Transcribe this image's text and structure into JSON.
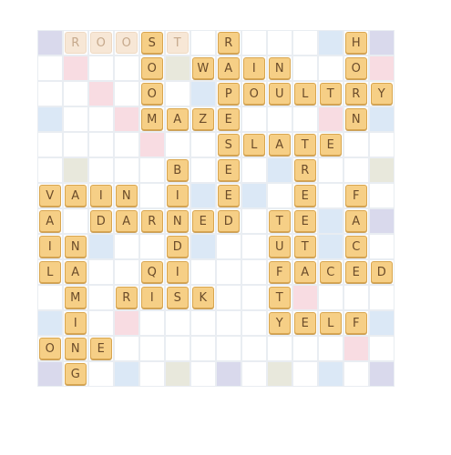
{
  "board": {
    "rows": 14,
    "cols": 14,
    "tiles": [
      {
        "r": 0,
        "c": 1,
        "l": "R",
        "ghost": true
      },
      {
        "r": 0,
        "c": 2,
        "l": "O",
        "ghost": true
      },
      {
        "r": 0,
        "c": 3,
        "l": "O",
        "ghost": true
      },
      {
        "r": 0,
        "c": 4,
        "l": "S"
      },
      {
        "r": 0,
        "c": 5,
        "l": "T",
        "ghost": true
      },
      {
        "r": 0,
        "c": 7,
        "l": "R"
      },
      {
        "r": 0,
        "c": 12,
        "l": "H"
      },
      {
        "r": 1,
        "c": 4,
        "l": "O"
      },
      {
        "r": 1,
        "c": 6,
        "l": "W"
      },
      {
        "r": 1,
        "c": 7,
        "l": "A"
      },
      {
        "r": 1,
        "c": 8,
        "l": "I"
      },
      {
        "r": 1,
        "c": 9,
        "l": "N"
      },
      {
        "r": 1,
        "c": 12,
        "l": "O"
      },
      {
        "r": 2,
        "c": 4,
        "l": "O"
      },
      {
        "r": 2,
        "c": 7,
        "l": "P"
      },
      {
        "r": 2,
        "c": 8,
        "l": "O"
      },
      {
        "r": 2,
        "c": 9,
        "l": "U"
      },
      {
        "r": 2,
        "c": 10,
        "l": "L"
      },
      {
        "r": 2,
        "c": 11,
        "l": "T"
      },
      {
        "r": 2,
        "c": 12,
        "l": "R"
      },
      {
        "r": 2,
        "c": 13,
        "l": "Y"
      },
      {
        "r": 3,
        "c": 4,
        "l": "M"
      },
      {
        "r": 3,
        "c": 5,
        "l": "A"
      },
      {
        "r": 3,
        "c": 6,
        "l": "Z"
      },
      {
        "r": 3,
        "c": 7,
        "l": "E"
      },
      {
        "r": 3,
        "c": 12,
        "l": "N"
      },
      {
        "r": 4,
        "c": 7,
        "l": "S"
      },
      {
        "r": 4,
        "c": 8,
        "l": "L"
      },
      {
        "r": 4,
        "c": 9,
        "l": "A"
      },
      {
        "r": 4,
        "c": 10,
        "l": "T"
      },
      {
        "r": 4,
        "c": 11,
        "l": "E"
      },
      {
        "r": 5,
        "c": 5,
        "l": "B"
      },
      {
        "r": 5,
        "c": 7,
        "l": "E"
      },
      {
        "r": 5,
        "c": 10,
        "l": "R"
      },
      {
        "r": 6,
        "c": 0,
        "l": "V"
      },
      {
        "r": 6,
        "c": 1,
        "l": "A"
      },
      {
        "r": 6,
        "c": 2,
        "l": "I"
      },
      {
        "r": 6,
        "c": 3,
        "l": "N"
      },
      {
        "r": 6,
        "c": 5,
        "l": "I"
      },
      {
        "r": 6,
        "c": 7,
        "l": "E"
      },
      {
        "r": 6,
        "c": 10,
        "l": "E"
      },
      {
        "r": 6,
        "c": 12,
        "l": "F"
      },
      {
        "r": 7,
        "c": 0,
        "l": "A"
      },
      {
        "r": 7,
        "c": 2,
        "l": "D"
      },
      {
        "r": 7,
        "c": 3,
        "l": "A"
      },
      {
        "r": 7,
        "c": 4,
        "l": "R"
      },
      {
        "r": 7,
        "c": 5,
        "l": "N"
      },
      {
        "r": 7,
        "c": 6,
        "l": "E"
      },
      {
        "r": 7,
        "c": 7,
        "l": "D"
      },
      {
        "r": 7,
        "c": 9,
        "l": "T"
      },
      {
        "r": 7,
        "c": 10,
        "l": "E"
      },
      {
        "r": 7,
        "c": 12,
        "l": "A"
      },
      {
        "r": 8,
        "c": 0,
        "l": "I"
      },
      {
        "r": 8,
        "c": 1,
        "l": "N"
      },
      {
        "r": 8,
        "c": 5,
        "l": "D"
      },
      {
        "r": 8,
        "c": 9,
        "l": "U"
      },
      {
        "r": 8,
        "c": 10,
        "l": "T"
      },
      {
        "r": 8,
        "c": 12,
        "l": "C"
      },
      {
        "r": 9,
        "c": 0,
        "l": "L"
      },
      {
        "r": 9,
        "c": 1,
        "l": "A"
      },
      {
        "r": 9,
        "c": 4,
        "l": "Q"
      },
      {
        "r": 9,
        "c": 5,
        "l": "I"
      },
      {
        "r": 9,
        "c": 9,
        "l": "F"
      },
      {
        "r": 9,
        "c": 10,
        "l": "A"
      },
      {
        "r": 9,
        "c": 11,
        "l": "C"
      },
      {
        "r": 9,
        "c": 12,
        "l": "E"
      },
      {
        "r": 9,
        "c": 13,
        "l": "D"
      },
      {
        "r": 10,
        "c": 1,
        "l": "M"
      },
      {
        "r": 10,
        "c": 3,
        "l": "R"
      },
      {
        "r": 10,
        "c": 4,
        "l": "I"
      },
      {
        "r": 10,
        "c": 5,
        "l": "S"
      },
      {
        "r": 10,
        "c": 6,
        "l": "K"
      },
      {
        "r": 10,
        "c": 9,
        "l": "T"
      },
      {
        "r": 11,
        "c": 1,
        "l": "I"
      },
      {
        "r": 11,
        "c": 9,
        "l": "Y"
      },
      {
        "r": 11,
        "c": 10,
        "l": "E"
      },
      {
        "r": 11,
        "c": 11,
        "l": "L"
      },
      {
        "r": 11,
        "c": 12,
        "l": "F"
      },
      {
        "r": 12,
        "c": 0,
        "l": "O"
      },
      {
        "r": 12,
        "c": 1,
        "l": "N"
      },
      {
        "r": 12,
        "c": 2,
        "l": "E"
      },
      {
        "r": 13,
        "c": 1,
        "l": "G"
      }
    ],
    "bonus": [
      {
        "r": 0,
        "c": 0,
        "t": "purple"
      },
      {
        "r": 0,
        "c": 11,
        "t": "blue"
      },
      {
        "r": 0,
        "c": 13,
        "t": "purple"
      },
      {
        "r": 1,
        "c": 1,
        "t": "pink"
      },
      {
        "r": 1,
        "c": 5,
        "t": "beige"
      },
      {
        "r": 1,
        "c": 13,
        "t": "pink"
      },
      {
        "r": 2,
        "c": 2,
        "t": "pink"
      },
      {
        "r": 2,
        "c": 6,
        "t": "blue"
      },
      {
        "r": 3,
        "c": 0,
        "t": "blue"
      },
      {
        "r": 3,
        "c": 3,
        "t": "pink"
      },
      {
        "r": 3,
        "c": 11,
        "t": "pink"
      },
      {
        "r": 3,
        "c": 13,
        "t": "blue"
      },
      {
        "r": 4,
        "c": 4,
        "t": "pink"
      },
      {
        "r": 5,
        "c": 1,
        "t": "beige"
      },
      {
        "r": 5,
        "c": 9,
        "t": "blue"
      },
      {
        "r": 5,
        "c": 13,
        "t": "beige"
      },
      {
        "r": 6,
        "c": 6,
        "t": "blue"
      },
      {
        "r": 6,
        "c": 8,
        "t": "blue"
      },
      {
        "r": 7,
        "c": 11,
        "t": "blue"
      },
      {
        "r": 7,
        "c": 13,
        "t": "purple"
      },
      {
        "r": 8,
        "c": 2,
        "t": "blue"
      },
      {
        "r": 8,
        "c": 6,
        "t": "blue"
      },
      {
        "r": 8,
        "c": 11,
        "t": "blue"
      },
      {
        "r": 10,
        "c": 10,
        "t": "pink"
      },
      {
        "r": 11,
        "c": 0,
        "t": "blue"
      },
      {
        "r": 11,
        "c": 3,
        "t": "pink"
      },
      {
        "r": 11,
        "c": 13,
        "t": "blue"
      },
      {
        "r": 12,
        "c": 12,
        "t": "pink"
      },
      {
        "r": 13,
        "c": 0,
        "t": "purple"
      },
      {
        "r": 13,
        "c": 3,
        "t": "blue"
      },
      {
        "r": 13,
        "c": 5,
        "t": "beige"
      },
      {
        "r": 13,
        "c": 7,
        "t": "purple"
      },
      {
        "r": 13,
        "c": 9,
        "t": "beige"
      },
      {
        "r": 13,
        "c": 11,
        "t": "blue"
      },
      {
        "r": 13,
        "c": 13,
        "t": "purple"
      }
    ]
  }
}
